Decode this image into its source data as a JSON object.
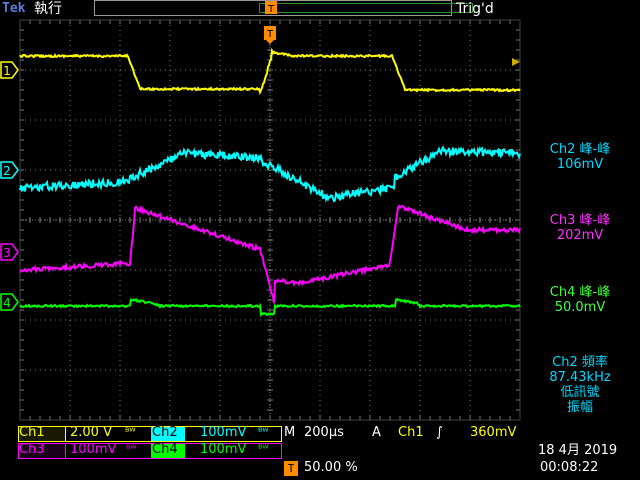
{
  "header": {
    "brand": "Tek",
    "mode": "執行",
    "trigger_status": "Trig'd",
    "trigger_marker": "T"
  },
  "channels": [
    {
      "id": "1",
      "color": "#ffff00"
    },
    {
      "id": "2",
      "color": "#00ffff"
    },
    {
      "id": "3",
      "color": "#ff00ff"
    },
    {
      "id": "4",
      "color": "#00ff00"
    }
  ],
  "measurements": {
    "ch2_pkpk_label": "Ch2 峰-峰",
    "ch2_pkpk_value": "106mV",
    "ch3_pkpk_label": "Ch3 峰-峰",
    "ch3_pkpk_value": "202mV",
    "ch4_pkpk_label": "Ch4 峰-峰",
    "ch4_pkpk_value": "50.0mV",
    "ch2_freq_label": "Ch2 頻率",
    "ch2_freq_value": "87.43kHz",
    "ch2_freq_note1": "低訊號",
    "ch2_freq_note2": "振幅"
  },
  "bottom": {
    "ch1_label": "Ch1",
    "ch1_scale": "2.00 V",
    "ch2_label": "Ch2",
    "ch2_scale": "100mV",
    "ch3_label": "Ch3",
    "ch3_scale": "100mV",
    "ch4_label": "Ch4",
    "ch4_scale": "100mV",
    "bw_symbol": "ᴮᵂ",
    "timebase_prefix": "M",
    "timebase": "200µs",
    "trigger_prefix": "A",
    "trigger_source": "Ch1",
    "trigger_slope": "∫",
    "trigger_level": "360mV",
    "trigger_position": "50.00 %",
    "date": "18 4月  2019",
    "time": "00:08:22"
  },
  "colors": {
    "ch1": "#ffff00",
    "ch2": "#00ffff",
    "ch3": "#ff00ff",
    "ch4": "#00ff00",
    "graticule": "#7a7a7a",
    "trigger": "#ff8c00"
  }
}
